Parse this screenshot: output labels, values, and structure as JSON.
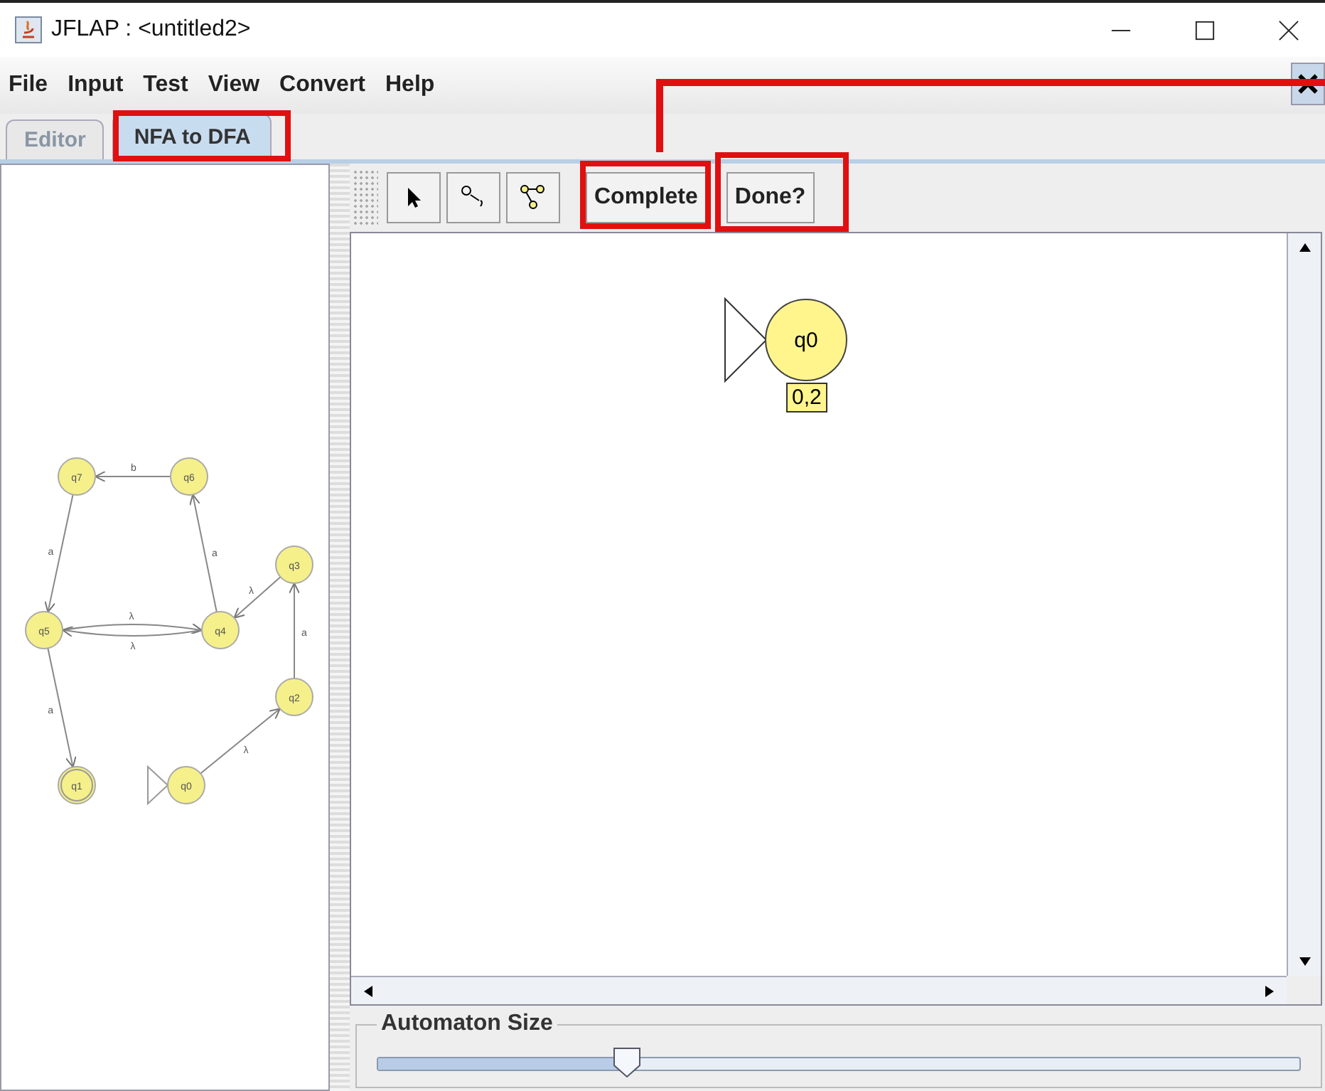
{
  "window": {
    "title": "JFLAP : <untitled2>"
  },
  "menu": [
    "File",
    "Input",
    "Test",
    "View",
    "Convert",
    "Help"
  ],
  "tabs": [
    {
      "label": "Editor",
      "selected": false
    },
    {
      "label": "NFA to DFA",
      "selected": true
    }
  ],
  "nfa": {
    "states": [
      {
        "label": "q0",
        "initial": true,
        "final": false
      },
      {
        "label": "q1",
        "initial": false,
        "final": true
      },
      {
        "label": "q2",
        "initial": false,
        "final": false
      },
      {
        "label": "q3",
        "initial": false,
        "final": false
      },
      {
        "label": "q4",
        "initial": false,
        "final": false
      },
      {
        "label": "q5",
        "initial": false,
        "final": false
      },
      {
        "label": "q6",
        "initial": false,
        "final": false
      },
      {
        "label": "q7",
        "initial": false,
        "final": false
      }
    ],
    "transitions": [
      {
        "label": "λ"
      },
      {
        "label": "a"
      },
      {
        "label": "λ"
      },
      {
        "label": "a"
      },
      {
        "label": "b"
      },
      {
        "label": "a"
      },
      {
        "label": "λ"
      },
      {
        "label": "λ"
      },
      {
        "label": "a"
      }
    ]
  },
  "toolbar": {
    "buttons": [
      "Complete",
      "Done?"
    ]
  },
  "dfa": {
    "states": [
      {
        "label": "q0",
        "initial": true,
        "final": false,
        "set": "0,2"
      }
    ]
  },
  "automaton_size": {
    "title": "Automaton Size",
    "level": 0.27
  }
}
